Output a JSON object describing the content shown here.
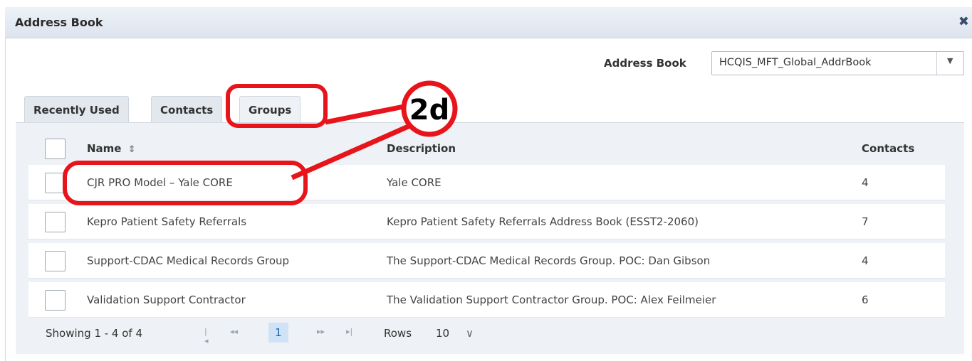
{
  "dialog": {
    "title": "Address Book",
    "close_glyph": "✖"
  },
  "address_book": {
    "label": "Address Book",
    "selected": "HCQIS_MFT_Global_AddrBook",
    "arrow_glyph": "▼"
  },
  "tabs": [
    {
      "label": "Recently Used"
    },
    {
      "label": "Contacts"
    },
    {
      "label": "Groups"
    }
  ],
  "table": {
    "headers": {
      "name": "Name",
      "sort_glyph": "⇕",
      "description": "Description",
      "contacts": "Contacts"
    },
    "rows": [
      {
        "name": "CJR PRO Model – Yale CORE",
        "description": "Yale CORE",
        "contacts": "4"
      },
      {
        "name": "Kepro Patient Safety Referrals",
        "description": "Kepro Patient Safety Referrals Address Book (ESST2-2060)",
        "contacts": "7"
      },
      {
        "name": "Support-CDAC Medical Records Group",
        "description": "The Support-CDAC Medical Records Group. POC: Dan Gibson",
        "contacts": "4"
      },
      {
        "name": "Validation Support Contractor",
        "description": "The Validation Support Contractor Group. POC: Alex Feilmeier",
        "contacts": "6"
      }
    ]
  },
  "footer": {
    "showing": "Showing 1 - 4 of 4",
    "first_glyph": "|◂",
    "prev_glyph": "◂◂",
    "current_page": "1",
    "next_glyph": "▸▸",
    "last_glyph": "▸|",
    "rows_label": "Rows",
    "rows_value": "10",
    "rows_arrow": "∨"
  },
  "annotation": {
    "badge": "2d",
    "color": "#e8141b"
  },
  "colors": {
    "titlebar": "#dde4ee",
    "panel": "#eef1f5",
    "page_highlight": "#cfe2f6",
    "link_blue": "#1b62b5"
  }
}
